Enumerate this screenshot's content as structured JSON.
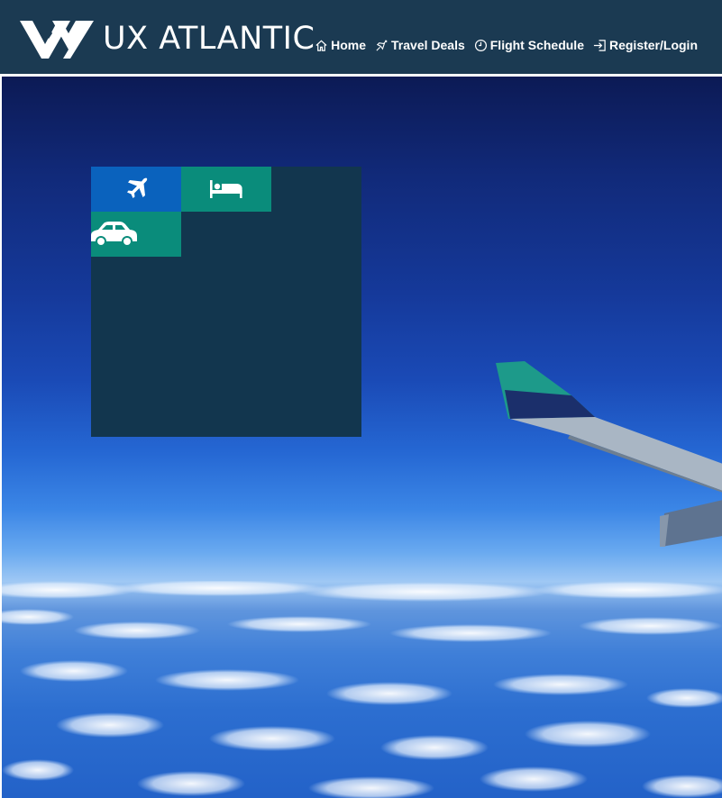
{
  "brand": {
    "name": "UX ATLANTIC",
    "logo_icon": "double-v-logo-icon"
  },
  "nav": {
    "items": [
      {
        "label": "Home",
        "icon": "home-icon"
      },
      {
        "label": "Travel Deals",
        "icon": "airplane-icon"
      },
      {
        "label": "Flight Schedule",
        "icon": "clock-icon"
      },
      {
        "label": "Register/Login",
        "icon": "sign-in-icon"
      }
    ]
  },
  "booking_widget": {
    "tabs": [
      {
        "icon": "airplane-icon",
        "color": "#0a62bd"
      },
      {
        "icon": "bed-icon",
        "color": "#0a8c7b"
      },
      {
        "icon": "car-icon",
        "color": "#0a8c7b"
      }
    ],
    "panel_color": "#12364e"
  },
  "colors": {
    "header_bg": "#1b3a52",
    "hero_sky_top": "#0c1a55",
    "hero_sky_horizon": "#9fc8f4"
  }
}
